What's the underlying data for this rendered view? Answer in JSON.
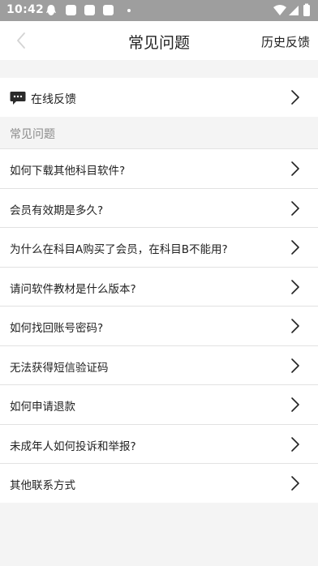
{
  "status_bar": {
    "time": "10:42"
  },
  "nav": {
    "title": "常见问题",
    "history_label": "历史反馈"
  },
  "online_feedback": {
    "label": "在线反馈"
  },
  "section": {
    "label": "常见问题"
  },
  "faq_items": [
    "如何下载其他科目软件?",
    "会员有效期是多久?",
    "为什么在科目A购买了会员，在科目B不能用?",
    "请问软件教材是什么版本?",
    "如何找回账号密码?",
    "无法获得短信验证码",
    "如何申请退款",
    "未成年人如何投诉和举报?",
    "其他联系方式"
  ],
  "colors": {
    "status_bar": "#9e9e9e",
    "page_bg": "#f4f4f4",
    "card_bg": "#ffffff",
    "divider": "#e2e2e2",
    "muted_text": "#8a8a8a"
  }
}
